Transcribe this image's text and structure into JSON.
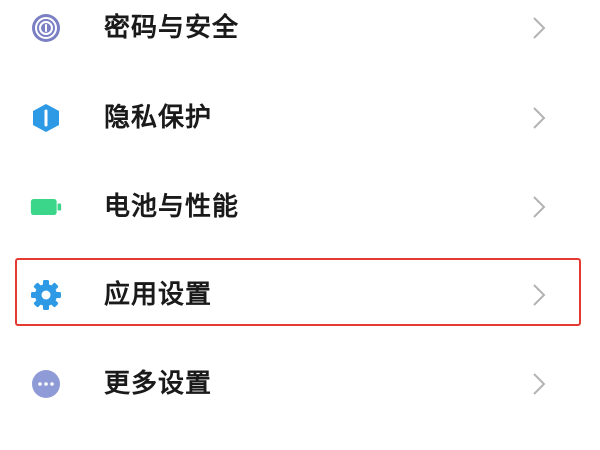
{
  "settings": {
    "items": [
      {
        "label": "密码与安全",
        "icon": "fingerprint-icon",
        "icon_color": "#7b7fc4"
      },
      {
        "label": "隐私保护",
        "icon": "shield-icon",
        "icon_color": "#2e9ae6"
      },
      {
        "label": "电池与性能",
        "icon": "battery-icon",
        "icon_color": "#3cd68a"
      },
      {
        "label": "应用设置",
        "icon": "gear-icon",
        "icon_color": "#2e9ae6",
        "highlighted": true
      },
      {
        "label": "更多设置",
        "icon": "more-dots-icon",
        "icon_color": "#8e9bd6"
      }
    ],
    "highlight_color": "#e53a32",
    "chevron_icon": "chevron-right-icon"
  }
}
